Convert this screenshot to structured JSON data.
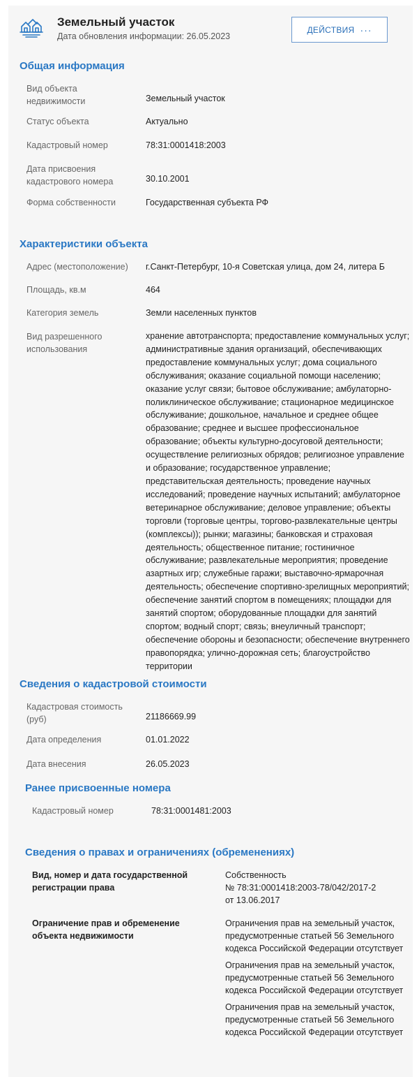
{
  "header": {
    "title": "Земельный участок",
    "subtitle": "Дата обновления информации: 26.05.2023",
    "actions_label": "ДЕЙСТВИЯ",
    "actions_dots": "···",
    "logo_icon": "land-plot-icon"
  },
  "general": {
    "title": "Общая информация",
    "rows": [
      {
        "label": "Вид объекта недвижимости",
        "value": "Земельный участок"
      },
      {
        "label": "Статус объекта",
        "value": "Актуально"
      },
      {
        "label": "Кадастровый номер",
        "value": "78:31:0001418:2003"
      },
      {
        "label": "Дата присвоения кадастрового номера",
        "value": "30.10.2001"
      },
      {
        "label": "Форма собственности",
        "value": "Государственная субъекта РФ"
      }
    ]
  },
  "characteristics": {
    "title": "Характеристики объекта",
    "rows": [
      {
        "label": "Адрес (местоположение)",
        "value": "г.Санкт-Петербург, 10-я Советская улица, дом 24, литера Б"
      },
      {
        "label": "Площадь, кв.м",
        "value": "464"
      },
      {
        "label": "Категория земель",
        "value": "Земли населенных пунктов"
      },
      {
        "label": "Вид разрешенного использования",
        "value": "хранение автотранспорта; предоставление коммунальных услуг; административные здания организаций, обеспечивающих предоставление коммунальных услуг; дома социального обслуживания; оказание социальной помощи населению; оказание услуг связи; бытовое обслуживание; амбулаторно-поликлиническое обслуживание; стационарное медицинское обслуживание; дошкольное, начальное и среднее общее образование; среднее и высшее профессиональное образование; объекты культурно-досуговой деятельности; осуществление религиозных обрядов; религиозное управление и образование; государственное управление; представительская деятельность; проведение научных исследований; проведение научных испытаний; амбулаторное ветеринарное обслуживание; деловое управление; объекты торговли (торговые центры, торгово-развлекательные центры (комплексы)); рынки; магазины; банковская и страховая деятельность; общественное питание; гостиничное обслуживание; развлекательные мероприятия; проведение азартных игр; служебные гаражи; выставочно-ярмарочная деятельность; обеспечение спортивно-зрелищных мероприятий; обеспечение занятий спортом в помещениях; площадки для занятий спортом; оборудованные площадки для занятий спортом; водный спорт; связь; внеуличный транспорт; обеспечение обороны и безопасности; обеспечение внутреннего правопорядка; улично-дорожная сеть; благоустройство территории"
      }
    ]
  },
  "cadastral_cost": {
    "title": "Сведения о кадастровой стоимости",
    "rows": [
      {
        "label": "Кадастровая стоимость (руб)",
        "value": "21186669.99"
      },
      {
        "label": "Дата определения",
        "value": "01.01.2022"
      },
      {
        "label": "Дата внесения",
        "value": "26.05.2023"
      }
    ]
  },
  "previous_numbers": {
    "title": "Ранее присвоенные номера",
    "rows": [
      {
        "label": "Кадастровый номер",
        "value": "78:31:0001481:2003"
      }
    ]
  },
  "rights": {
    "title": "Сведения о правах и ограничениях (обременениях)",
    "registration": {
      "label": "Вид, номер и дата государственной регистрации права",
      "lines": [
        "Собственность",
        "№ 78:31:0001418:2003-78/042/2017-2",
        "от 13.06.2017"
      ]
    },
    "restrictions": {
      "label": "Ограничение прав и обременение объекта недвижимости",
      "items": [
        "Ограничения прав на земельный участок, предусмотренные статьей 56 Земельного кодекса Российской Федерации отсутствует",
        "Ограничения прав на земельный участок, предусмотренные статьей 56 Земельного кодекса Российской Федерации отсутствует",
        "Ограничения прав на земельный участок, предусмотренные статьей 56 Земельного кодекса Российской Федерации отсутствует"
      ]
    }
  },
  "colors": {
    "accent": "#2a78c4",
    "panel_bg": "#f6f6f6",
    "button_border": "#6a98cf"
  }
}
